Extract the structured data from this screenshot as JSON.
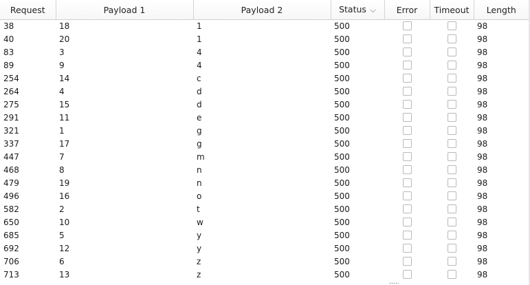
{
  "columns": {
    "request": "Request",
    "payload1": "Payload 1",
    "payload2": "Payload 2",
    "status": "Status",
    "error": "Error",
    "timeout": "Timeout",
    "length": "Length"
  },
  "sort": {
    "column": "status",
    "icon": "chevron-down-icon"
  },
  "rows": [
    {
      "request": "38",
      "payload1": "18",
      "payload2": "1",
      "status": "500",
      "error": false,
      "timeout": false,
      "length": "98"
    },
    {
      "request": "40",
      "payload1": "20",
      "payload2": "1",
      "status": "500",
      "error": false,
      "timeout": false,
      "length": "98"
    },
    {
      "request": "83",
      "payload1": "3",
      "payload2": "4",
      "status": "500",
      "error": false,
      "timeout": false,
      "length": "98"
    },
    {
      "request": "89",
      "payload1": "9",
      "payload2": "4",
      "status": "500",
      "error": false,
      "timeout": false,
      "length": "98"
    },
    {
      "request": "254",
      "payload1": "14",
      "payload2": "c",
      "status": "500",
      "error": false,
      "timeout": false,
      "length": "98"
    },
    {
      "request": "264",
      "payload1": "4",
      "payload2": "d",
      "status": "500",
      "error": false,
      "timeout": false,
      "length": "98"
    },
    {
      "request": "275",
      "payload1": "15",
      "payload2": "d",
      "status": "500",
      "error": false,
      "timeout": false,
      "length": "98"
    },
    {
      "request": "291",
      "payload1": "11",
      "payload2": "e",
      "status": "500",
      "error": false,
      "timeout": false,
      "length": "98"
    },
    {
      "request": "321",
      "payload1": "1",
      "payload2": "g",
      "status": "500",
      "error": false,
      "timeout": false,
      "length": "98"
    },
    {
      "request": "337",
      "payload1": "17",
      "payload2": "g",
      "status": "500",
      "error": false,
      "timeout": false,
      "length": "98"
    },
    {
      "request": "447",
      "payload1": "7",
      "payload2": "m",
      "status": "500",
      "error": false,
      "timeout": false,
      "length": "98"
    },
    {
      "request": "468",
      "payload1": "8",
      "payload2": "n",
      "status": "500",
      "error": false,
      "timeout": false,
      "length": "98"
    },
    {
      "request": "479",
      "payload1": "19",
      "payload2": "n",
      "status": "500",
      "error": false,
      "timeout": false,
      "length": "98"
    },
    {
      "request": "496",
      "payload1": "16",
      "payload2": "o",
      "status": "500",
      "error": false,
      "timeout": false,
      "length": "98"
    },
    {
      "request": "582",
      "payload1": "2",
      "payload2": "t",
      "status": "500",
      "error": false,
      "timeout": false,
      "length": "98"
    },
    {
      "request": "650",
      "payload1": "10",
      "payload2": "w",
      "status": "500",
      "error": false,
      "timeout": false,
      "length": "98"
    },
    {
      "request": "685",
      "payload1": "5",
      "payload2": "y",
      "status": "500",
      "error": false,
      "timeout": false,
      "length": "98"
    },
    {
      "request": "692",
      "payload1": "12",
      "payload2": "y",
      "status": "500",
      "error": false,
      "timeout": false,
      "length": "98"
    },
    {
      "request": "706",
      "payload1": "6",
      "payload2": "z",
      "status": "500",
      "error": false,
      "timeout": false,
      "length": "98"
    },
    {
      "request": "713",
      "payload1": "13",
      "payload2": "z",
      "status": "500",
      "error": false,
      "timeout": false,
      "length": "98"
    }
  ]
}
